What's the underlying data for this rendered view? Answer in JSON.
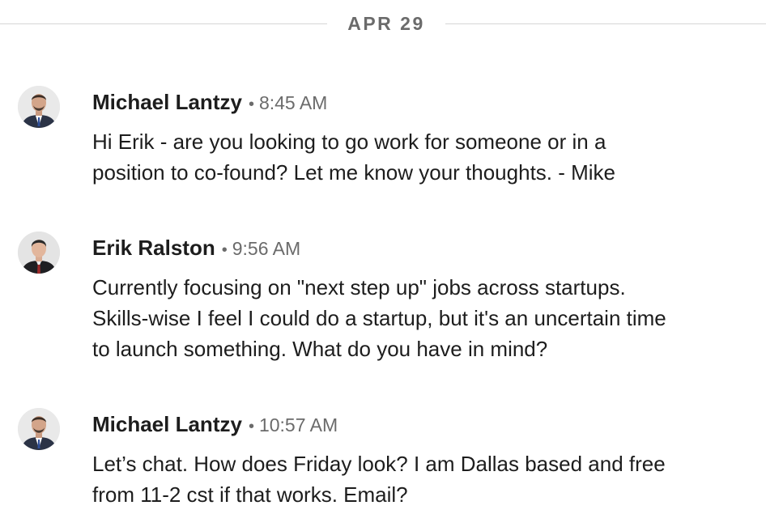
{
  "date_divider": "APR 29",
  "messages": [
    {
      "sender": "Michael Lantzy",
      "time": "8:45 AM",
      "text": "Hi Erik - are you looking to go work for someone or in a\nposition to co-found?  Let me know your thoughts. - Mike"
    },
    {
      "sender": "Erik Ralston",
      "time": "9:56 AM",
      "text": "Currently focusing on \"next step up\" jobs across startups.\nSkills-wise I feel I could do a startup, but it's an uncertain time\nto launch something. What do you have in mind?"
    },
    {
      "sender": "Michael Lantzy",
      "time": "10:57 AM",
      "text": "Let’s chat. How does Friday look? I am Dallas based and free\nfrom 11-2 cst if that works. Email?"
    }
  ],
  "separator": "•",
  "colors": {
    "text": "#1d1d1d",
    "muted": "#6b6b6b",
    "divider": "#d6d6d6"
  }
}
